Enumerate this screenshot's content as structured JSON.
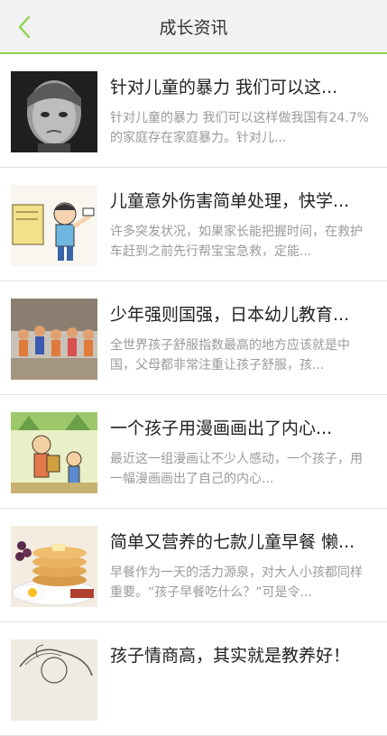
{
  "header": {
    "title": "成长资讯",
    "back_icon": "chevron-left-icon",
    "accent": "#8fd14f"
  },
  "articles": [
    {
      "title": "针对儿童的暴力  我们可以这...",
      "summary": "针对儿童的暴力 我们可以这样做我国有24.7%的家庭存在家庭暴力。针对儿...",
      "thumb": "crying-child-photo"
    },
    {
      "title": "儿童意外伤害简单处理，快学...",
      "summary": "许多突发状况，如果家长能把握时间，在救护车赶到之前先行帮宝宝急救，定能...",
      "thumb": "cartoon-boy-illustration"
    },
    {
      "title": "少年强则国强，日本幼儿教育...",
      "summary": "全世界孩子舒服指数最高的地方应该就是中国，父母都非常注重让孩子舒服，孩...",
      "thumb": "japanese-kids-photo"
    },
    {
      "title": "一个孩子用漫画画出了内心...",
      "summary": "最近这一组漫画让不少人感动，一个孩子，用一幅漫画画出了自己的内心...",
      "thumb": "comic-drawing-illustration"
    },
    {
      "title": "简单又营养的七款儿童早餐 懒...",
      "summary": "早餐作为一天的活力源泉，对大人小孩都同样重要。“孩子早餐吃什么？”可是令...",
      "thumb": "pancake-breakfast-photo"
    },
    {
      "title": "孩子情商高，其实就是教养好！",
      "summary": "",
      "thumb": "sketch-illustration"
    }
  ]
}
